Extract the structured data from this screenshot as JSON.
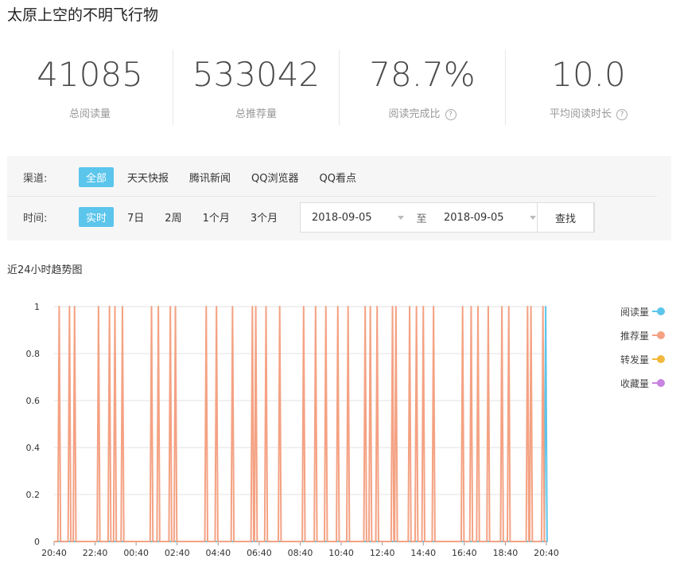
{
  "page_title": "太原上空的不明飞行物",
  "stats": [
    {
      "value": "41085",
      "label": "总阅读量",
      "help": false
    },
    {
      "value": "533042",
      "label": "总推荐量",
      "help": false
    },
    {
      "value": "78.7%",
      "label": "阅读完成比",
      "help": true
    },
    {
      "value": "10.0",
      "label": "平均阅读时长",
      "help": true
    }
  ],
  "help_glyph": "?",
  "filters": {
    "channel_label": "渠道:",
    "channel_options": [
      "全部",
      "天天快报",
      "腾讯新闻",
      "QQ浏览器",
      "QQ看点"
    ],
    "channel_active": 0,
    "time_label": "时间:",
    "time_options": [
      "实时",
      "7日",
      "2周",
      "1个月",
      "3个月"
    ],
    "time_active": 0,
    "start_date": "2018-09-05",
    "separator": "至",
    "end_date": "2018-09-05",
    "search_label": "查找"
  },
  "chart_section_title": "近24小时趋势图",
  "chart_data": {
    "type": "line",
    "x_tick_labels": [
      "20:40",
      "22:40",
      "00:40",
      "02:40",
      "04:40",
      "06:40",
      "08:40",
      "10:40",
      "12:40",
      "14:40",
      "16:40",
      "18:40",
      "20:40"
    ],
    "y_tick_labels": [
      "0",
      "0.2",
      "0.4",
      "0.6",
      "0.8",
      "1"
    ],
    "ylim": [
      0,
      1
    ],
    "grid": true,
    "legend_position": "right",
    "series": [
      {
        "name": "阅读量",
        "color": "#5bc5ec",
        "spikes_minutes": [
          1438
        ]
      },
      {
        "name": "推荐量",
        "color": "#f4a283",
        "spikes_minutes": [
          15,
          45,
          60,
          130,
          162,
          178,
          200,
          285,
          305,
          340,
          355,
          445,
          475,
          522,
          580,
          590,
          620,
          660,
          730,
          765,
          795,
          830,
          860,
          910,
          925,
          945,
          990,
          1000,
          1040,
          1060,
          1080,
          1110,
          1195,
          1220,
          1240,
          1270,
          1310,
          1330,
          1385,
          1395,
          1430
        ]
      },
      {
        "name": "转发量",
        "color": "#f0b93c",
        "spikes_minutes": []
      },
      {
        "name": "收藏量",
        "color": "#c983e0",
        "spikes_minutes": []
      }
    ]
  }
}
